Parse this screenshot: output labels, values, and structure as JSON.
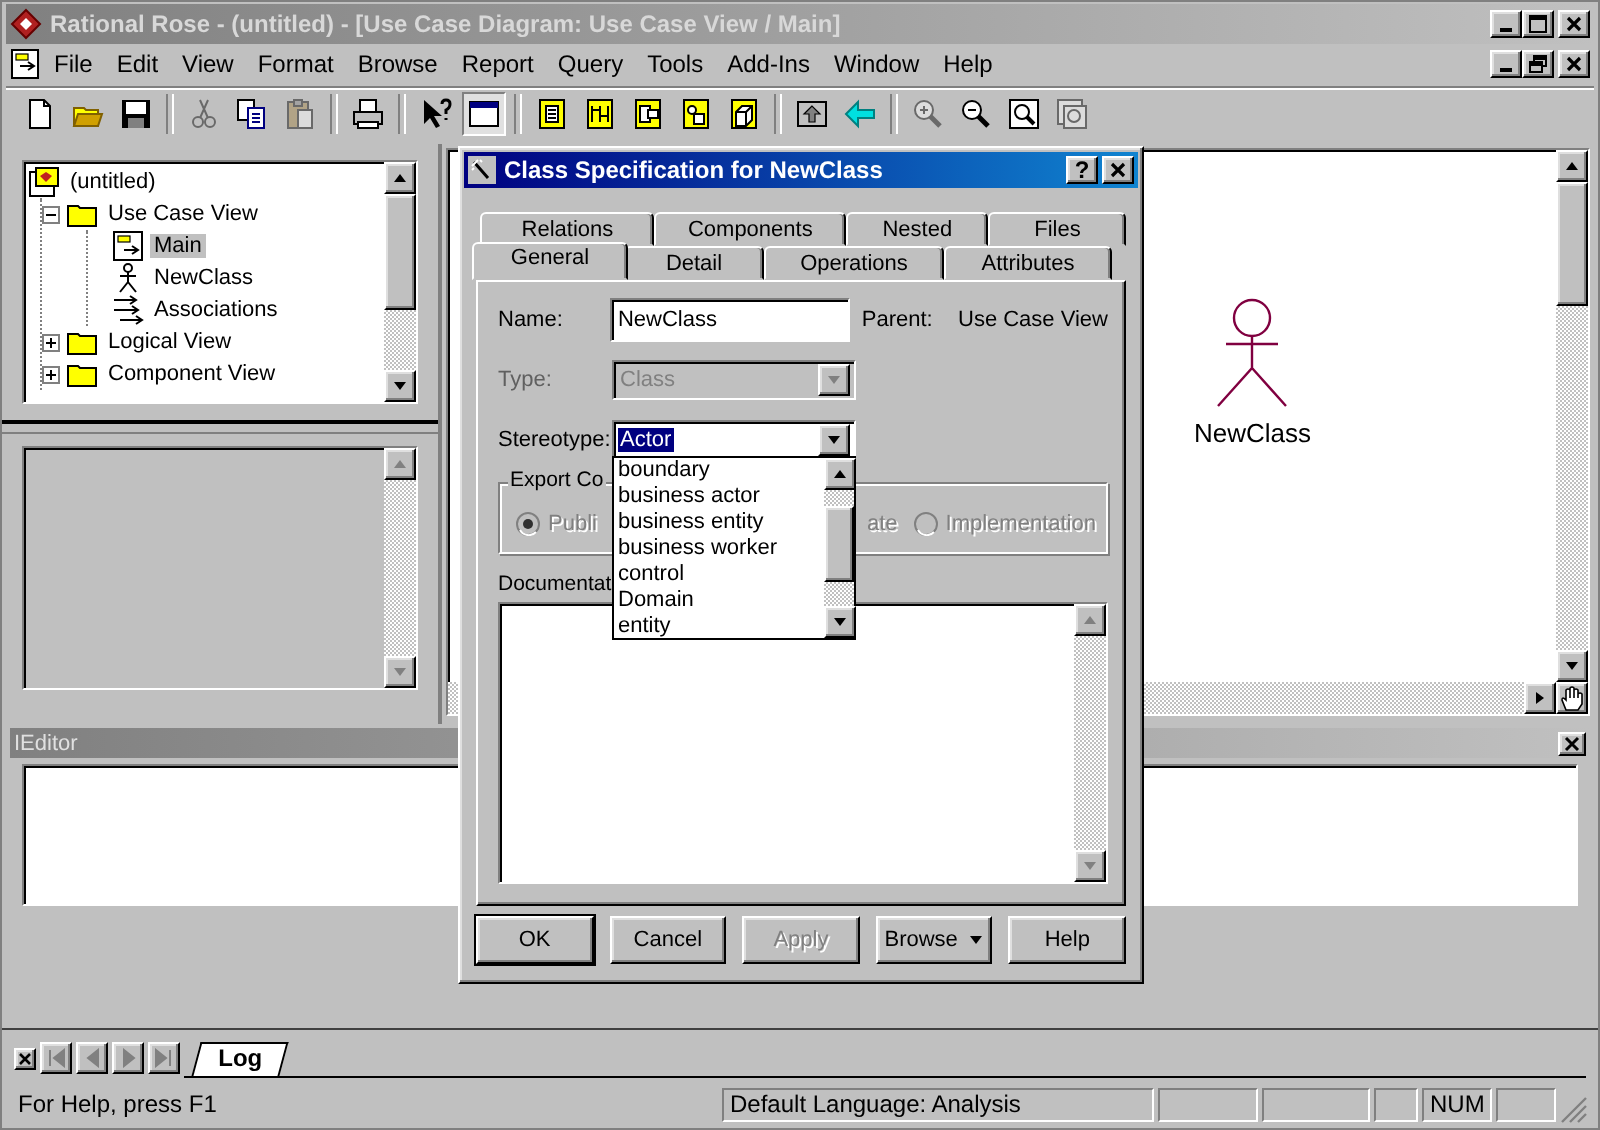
{
  "window": {
    "title": "Rational Rose - (untitled) - [Use Case Diagram: Use Case View / Main]"
  },
  "menu": [
    "File",
    "Edit",
    "View",
    "Format",
    "Browse",
    "Report",
    "Query",
    "Tools",
    "Add-Ins",
    "Window",
    "Help"
  ],
  "toolbar": [
    [
      {
        "kind": "new",
        "pressed": false,
        "disabled": false
      },
      {
        "kind": "open",
        "pressed": false,
        "disabled": false
      },
      {
        "kind": "save",
        "pressed": false,
        "disabled": false
      }
    ],
    [
      {
        "kind": "cut",
        "pressed": false,
        "disabled": true
      },
      {
        "kind": "copy",
        "pressed": false,
        "disabled": false
      },
      {
        "kind": "paste",
        "pressed": false,
        "disabled": true
      }
    ],
    [
      {
        "kind": "print",
        "pressed": false,
        "disabled": false
      }
    ],
    [
      {
        "kind": "help-pointer",
        "pressed": false,
        "disabled": false
      },
      {
        "kind": "window",
        "pressed": true,
        "disabled": false
      }
    ],
    [
      {
        "kind": "doc-a",
        "pressed": false,
        "disabled": false
      },
      {
        "kind": "doc-b",
        "pressed": false,
        "disabled": false
      },
      {
        "kind": "doc-c",
        "pressed": false,
        "disabled": false
      },
      {
        "kind": "doc-d",
        "pressed": false,
        "disabled": false
      },
      {
        "kind": "doc-e",
        "pressed": false,
        "disabled": false
      }
    ],
    [
      {
        "kind": "up",
        "pressed": false,
        "disabled": false
      },
      {
        "kind": "back",
        "pressed": false,
        "disabled": false
      }
    ],
    [
      {
        "kind": "zoom-in",
        "pressed": false,
        "disabled": true
      },
      {
        "kind": "zoom-out",
        "pressed": false,
        "disabled": false
      },
      {
        "kind": "fit",
        "pressed": false,
        "disabled": false
      },
      {
        "kind": "unfit",
        "pressed": false,
        "disabled": true
      }
    ]
  ],
  "browser": {
    "tree": [
      {
        "label": "(untitled)",
        "kind": "model",
        "selected": false,
        "children": [
          {
            "label": "Use Case View",
            "kind": "folder",
            "selected": false,
            "expanded": true,
            "children": [
              {
                "label": "Main",
                "kind": "diagram",
                "selected": true
              },
              {
                "label": "NewClass",
                "kind": "actor",
                "selected": false
              },
              {
                "label": "Associations",
                "kind": "associations",
                "selected": false
              }
            ]
          },
          {
            "label": "Logical View",
            "kind": "folder",
            "selected": false,
            "expanded": false
          },
          {
            "label": "Component View",
            "kind": "folder",
            "selected": false,
            "expanded": false
          }
        ]
      }
    ]
  },
  "diagram": {
    "actors": [
      {
        "label": "NewClass"
      }
    ]
  },
  "editor": {
    "title": "IEditor"
  },
  "log_tabs": [
    {
      "label": "Log",
      "selected": true
    }
  ],
  "status_bar": {
    "help": "For Help, press F1",
    "language": "Default Language: Analysis",
    "num": "NUM"
  },
  "dialog": {
    "title": "Class Specification for NewClass",
    "help_button": "?",
    "tab_rows": [
      [
        {
          "label": "Relations",
          "selected": false
        },
        {
          "label": "Components",
          "selected": false
        },
        {
          "label": "Nested",
          "selected": false
        },
        {
          "label": "Files",
          "selected": false
        }
      ],
      [
        {
          "label": "General",
          "selected": true
        },
        {
          "label": "Detail",
          "selected": false
        },
        {
          "label": "Operations",
          "selected": false
        },
        {
          "label": "Attributes",
          "selected": false
        }
      ]
    ],
    "name": {
      "label": "Name:",
      "value": "NewClass"
    },
    "parent": {
      "label": "Parent:",
      "value": "Use Case View"
    },
    "type": {
      "label": "Type:",
      "value": "Class",
      "disabled": true
    },
    "stereotype": {
      "label": "Stereotype:",
      "value": "Actor",
      "disabled": false,
      "expanded": true,
      "options": [
        {
          "label": "boundary",
          "selected": false
        },
        {
          "label": "business actor",
          "selected": false
        },
        {
          "label": "business entity",
          "selected": false
        },
        {
          "label": "business worker",
          "selected": false
        },
        {
          "label": "control",
          "selected": false
        },
        {
          "label": "Domain",
          "selected": false
        },
        {
          "label": "entity",
          "selected": false
        }
      ]
    },
    "export_control": {
      "label": "Export Co",
      "options": [
        {
          "label": "Publi",
          "selected": true,
          "disabled": true
        },
        {
          "label": "ate",
          "kind": "text"
        },
        {
          "label": "Implementation",
          "selected": false,
          "disabled": true
        }
      ]
    },
    "documentation": {
      "label": "Documentat"
    },
    "buttons": [
      {
        "label": "OK",
        "disabled": false,
        "kind": "plain"
      },
      {
        "label": "Cancel",
        "disabled": false,
        "kind": "plain"
      },
      {
        "label": "Apply",
        "disabled": true,
        "kind": "plain"
      },
      {
        "label": "Browse",
        "disabled": false,
        "kind": "menu"
      },
      {
        "label": "Help",
        "disabled": false,
        "kind": "plain"
      }
    ]
  }
}
